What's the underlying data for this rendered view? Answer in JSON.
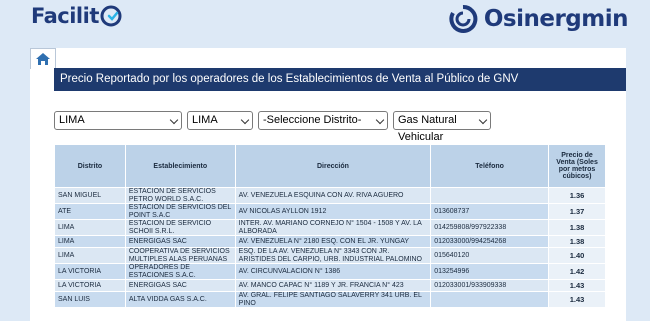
{
  "header": {
    "left_brand": "Facilit",
    "right_brand": "Osinergmin"
  },
  "title": "Precio Reportado por los operadores de los Establecimientos de Venta al Público de GNV",
  "filters": {
    "departamento": "LIMA",
    "provincia": "LIMA",
    "distrito": "-Seleccione Distrito-",
    "combustible": "Gas Natural Vehicular"
  },
  "table": {
    "headers": {
      "distrito": "Distrito",
      "establecimiento": "Establecimiento",
      "direccion": "Dirección",
      "telefono": "Teléfono",
      "precio": "Precio de Venta (Soles por metros cúbicos)"
    },
    "rows": [
      {
        "distrito": "SAN MIGUEL",
        "establecimiento": "ESTACION DE SERVICIOS PETRO WORLD S.A.C.",
        "direccion": "AV. VENEZUELA ESQUINA CON AV. RIVA AGUERO",
        "telefono": "",
        "precio": "1.36"
      },
      {
        "distrito": "ATE",
        "establecimiento": "ESTACION DE SERVICIOS DEL POINT S.A.C",
        "direccion": "AV NICOLAS AYLLON 1912",
        "telefono": "013608737",
        "precio": "1.37"
      },
      {
        "distrito": "LIMA",
        "establecimiento": "ESTACION DE SERVICIO SCHOII S.R.L.",
        "direccion": "INTER. AV. MARIANO CORNEJO N° 1504 - 1508 Y AV. LA ALBORADA",
        "telefono": "014259808/997922338",
        "precio": "1.38"
      },
      {
        "distrito": "LIMA",
        "establecimiento": "ENERGIGAS SAC",
        "direccion": "AV. VENEZUELA N° 2180 ESQ. CON EL JR. YUNGAY",
        "telefono": "012033000/994254268",
        "precio": "1.38"
      },
      {
        "distrito": "LIMA",
        "establecimiento": "COOPERATIVA DE SERVICIOS MULTIPLES ALAS PERUANAS",
        "direccion": "ESQ. DE LA AV. VENEZUELA N° 3343 CON JR. ARISTIDES DEL CARPIO, URB. INDUSTRIAL PALOMINO",
        "telefono": "015640120",
        "precio": "1.40"
      },
      {
        "distrito": "LA VICTORIA",
        "establecimiento": "OPERADORES DE ESTACIONES S.A.C.",
        "direccion": "AV. CIRCUNVALACION N° 1386",
        "telefono": "013254996",
        "precio": "1.42"
      },
      {
        "distrito": "LA VICTORIA",
        "establecimiento": "ENERGIGAS SAC",
        "direccion": "AV. MANCO CAPAC N° 1189 Y JR. FRANCIA N° 423",
        "telefono": "012033001/933909338",
        "precio": "1.43"
      },
      {
        "distrito": "SAN LUIS",
        "establecimiento": "ALTA VIDDA GAS S.A.C.",
        "direccion": "AV. GRAL. FELIPE SANTIAGO SALAVERRY 341 URB. EL PINO",
        "telefono": "",
        "precio": "1.43"
      }
    ]
  }
}
